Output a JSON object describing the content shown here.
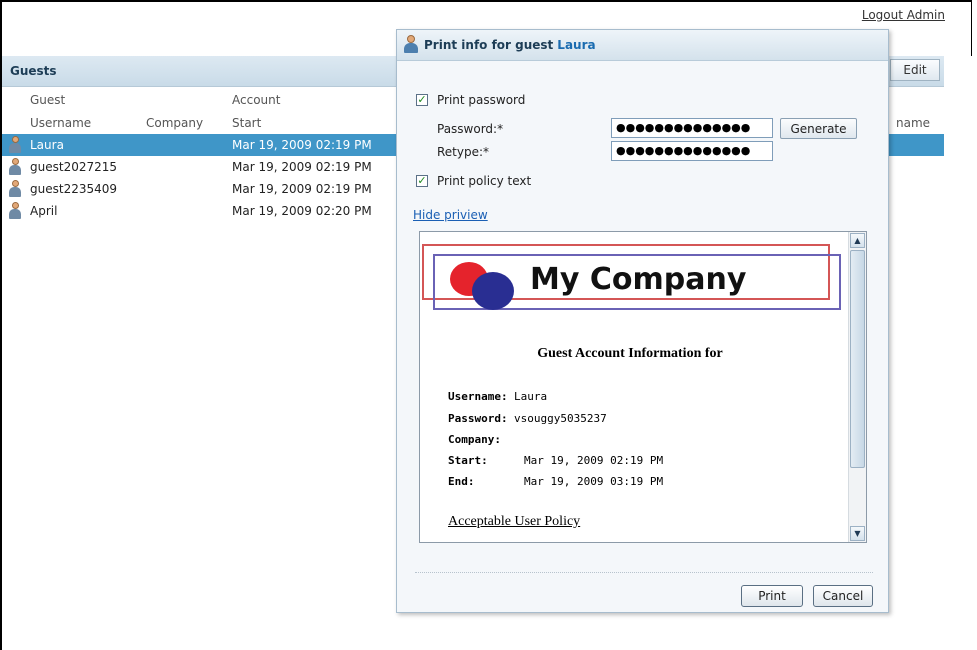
{
  "header": {
    "logout_link": "Logout Admin"
  },
  "guests_panel": {
    "title": "Guests",
    "edit_label": "Edit",
    "group_headers": {
      "guest": "Guest",
      "account": "Account"
    },
    "columns": {
      "username": "Username",
      "company": "Company",
      "start": "Start",
      "name_partial": "name"
    },
    "rows": [
      {
        "username": "Laura",
        "company": "",
        "start": "Mar 19, 2009 02:19 PM",
        "selected": true
      },
      {
        "username": "guest2027215",
        "company": "",
        "start": "Mar 19, 2009 02:19 PM",
        "selected": false
      },
      {
        "username": "guest2235409",
        "company": "",
        "start": "Mar 19, 2009 02:19 PM",
        "selected": false
      },
      {
        "username": "April",
        "company": "",
        "start": "Mar 19, 2009 02:20 PM",
        "selected": false
      }
    ]
  },
  "dialog": {
    "title": "Print info for guest",
    "guest_name": "Laura",
    "print_password": {
      "label": "Print password",
      "checked": true
    },
    "password_label": "Password:*",
    "password_value": "●●●●●●●●●●●●●●",
    "retype_label": "Retype:*",
    "retype_value": "●●●●●●●●●●●●●●",
    "generate_label": "Generate",
    "print_policy": {
      "label": "Print policy text",
      "checked": true
    },
    "hide_preview_link": "Hide priview",
    "preview": {
      "company_name": "My Company",
      "heading": "Guest Account Information for",
      "username_label": "Username:",
      "username_value": "Laura",
      "password_label": "Password:",
      "password_value": "vsouggy5035237",
      "company_label": "Company:",
      "company_value": "",
      "start_label": "Start:",
      "start_value": "Mar 19, 2009 02:19 PM",
      "end_label": "End:",
      "end_value": "Mar 19, 2009 03:19 PM",
      "policy_link": "Acceptable User Policy"
    },
    "print_label": "Print",
    "cancel_label": "Cancel"
  },
  "colors": {
    "selection": "#3f96c8",
    "link": "#1a5fb4",
    "header_bg": "#d3e2ed"
  }
}
